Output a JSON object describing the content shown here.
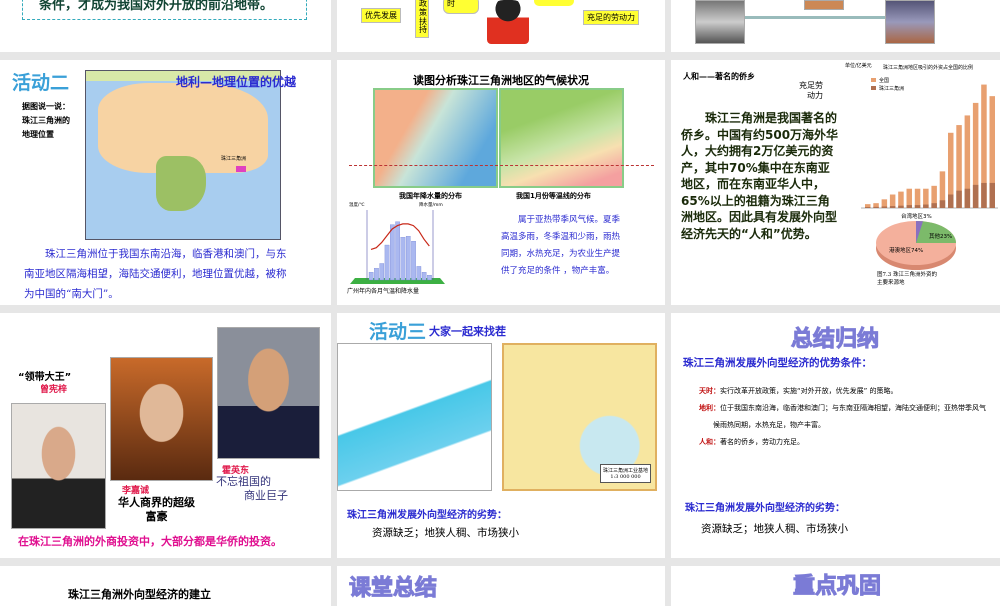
{
  "slides": [
    {
      "text": "条件，才成为我国对外开放的前沿地带。"
    },
    {
      "boxes": [
        "优先发展",
        "政策扶持",
        "时",
        "充足的劳动力"
      ]
    },
    {},
    {
      "activity": "活动二",
      "title": "地利—地理位置的优越",
      "prompt": [
        "据图说一说：",
        "珠江三角洲的",
        "地理位置"
      ],
      "map_label": "珠江三角洲",
      "body": "珠江三角洲位于我国东南沿海，临香港和澳门，与东南亚地区隔海相望，海陆交通便利，地理位置优越，被称为中国的“南大门”。"
    },
    {
      "title": "读图分析珠江三角洲地区的气候状况",
      "map1_caption": "我国年降水量的分布",
      "map2_caption": "我国1月份等温线的分布",
      "chart_caption": "广州年内各月气温和降水量",
      "y1_label": "温度/℃",
      "y2_label": "降水量/mm",
      "body": "属于亚热带季风气候。夏季高温多雨，冬季温和少雨，雨热同期，水热充足，为农业生产提供了充足的条件 ，物产丰富。"
    },
    {
      "heading": "人和——著名的侨乡",
      "labor": [
        "充足劳",
        "动力"
      ],
      "body": "珠江三角洲是我国著名的侨乡。中国有约500万海外华人，大约拥有2万亿美元的资产，其中70%集中在东南亚地区，而在东南亚华人中， 65%以上的祖籍为珠江三角洲地区。因此具有发展外向型经济先天的“人和”优势。",
      "bar_title": "珠江三角洲地区吸引的外资占全国的比例",
      "bar_unit": "单位/亿美元",
      "legend": [
        "全国",
        "珠江三角洲"
      ],
      "pie_labels": [
        "台湾地区3%",
        "其他23%",
        "港澳地区74%"
      ],
      "pie_caption": [
        "图7.3  珠江三角洲外资的",
        "主要来源地"
      ]
    },
    {
      "label1": "“领带大王”",
      "name1": "曾宪梓",
      "name2": "李嘉诚",
      "desc2": [
        "华人商界的超级",
        "富豪"
      ],
      "name3": "霍英东",
      "desc3": [
        "不忘祖国的",
        "商业巨子"
      ],
      "footer": "在珠江三角洲的外商投资中，大部分都是华侨的投资。"
    },
    {
      "activity": "活动三",
      "title": "大家一起来找茬",
      "map_label": [
        "珠江三角洲工业基地",
        "1:3 000 000"
      ],
      "heading": "珠江三角洲发展外向型经济的劣势：",
      "body": "资源缺乏；地狭人稠、市场狭小"
    },
    {
      "title": "总结归纳",
      "heading": "珠江三角洲发展外向型经济的优势条件：",
      "items": [
        {
          "k": "天时：",
          "v": "实行改革开放政策，实施“对外开放，优先发展” 的策略。"
        },
        {
          "k": "地利：",
          "v": "位于我国东南沿海，临香港和澳门；与东南亚隔海相望，海陆交通便利；亚热带季风气候雨热同期，水热充足，物产丰富。"
        },
        {
          "k": "人和：",
          "v": "著名的侨乡，劳动力充足。"
        }
      ],
      "heading2": "珠江三角洲发展外向型经济的劣势：",
      "body2": "资源缺乏；地狭人稠、市场狭小"
    },
    {
      "title": "珠江三角洲外向型经济的建立"
    },
    {
      "title": "课堂总结"
    },
    {
      "title": "重点巩固"
    }
  ],
  "chart_data": [
    {
      "type": "bar",
      "title": "珠江三角洲地区吸引的外资占全国的比例",
      "ylabel": "单位/亿美元",
      "ylim": [
        0,
        700
      ],
      "series": [
        {
          "name": "全国",
          "values": [
            20,
            25,
            45,
            70,
            85,
            100,
            100,
            100,
            115,
            190,
            390,
            430,
            480,
            545,
            640,
            580
          ]
        },
        {
          "name": "珠江三角洲",
          "values": [
            5,
            6,
            8,
            10,
            12,
            15,
            15,
            18,
            25,
            40,
            70,
            90,
            100,
            120,
            130,
            130
          ]
        }
      ]
    },
    {
      "type": "pie",
      "values": [
        3,
        23,
        74
      ],
      "labels": [
        "台湾地区",
        "其他",
        "港澳地区"
      ]
    },
    {
      "type": "bar+line",
      "title": "广州年内各月气温和降水量",
      "x": [
        1,
        2,
        3,
        4,
        5,
        6,
        7,
        8,
        9,
        10,
        11,
        12
      ],
      "temperature": [
        13,
        14,
        17,
        21,
        25,
        27,
        28,
        28,
        27,
        24,
        19,
        15
      ],
      "precipitation": [
        40,
        60,
        85,
        180,
        285,
        300,
        220,
        225,
        200,
        70,
        40,
        25
      ],
      "ylim_temp": [
        -5,
        35
      ],
      "ylim_precip": [
        0,
        350
      ]
    }
  ],
  "colors": {
    "bg": "#e6e6e6",
    "title_blue": "#2b2bd0",
    "accent_red": "#e0184a",
    "activity": "#3aa0d8"
  }
}
